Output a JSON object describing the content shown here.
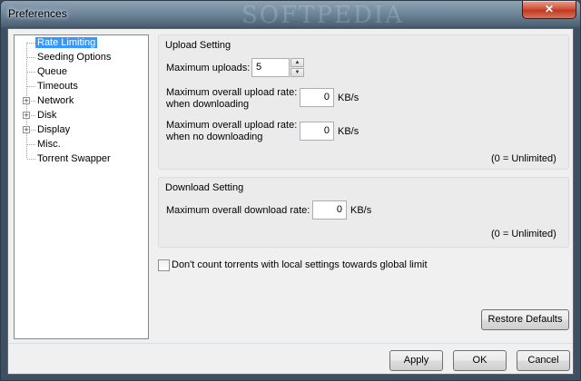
{
  "window": {
    "title": "Preferences",
    "close_glyph": "✕",
    "watermark": "SOFTPEDIA"
  },
  "tree": {
    "items": [
      {
        "label": "Rate Limiting",
        "selected": true,
        "expandable": false
      },
      {
        "label": "Seeding Options",
        "expandable": false
      },
      {
        "label": "Queue",
        "expandable": false
      },
      {
        "label": "Timeouts",
        "expandable": false
      },
      {
        "label": "Network",
        "expandable": true
      },
      {
        "label": "Disk",
        "expandable": true
      },
      {
        "label": "Display",
        "expandable": true
      },
      {
        "label": "Misc.",
        "expandable": false
      },
      {
        "label": "Torrent Swapper",
        "expandable": false
      }
    ],
    "expand_glyph": "+"
  },
  "upload": {
    "title": "Upload Setting",
    "max_uploads_label": "Maximum uploads:",
    "max_uploads_value": "5",
    "rate_downloading_label_1": "Maximum overall upload rate:",
    "rate_downloading_label_2": "when downloading",
    "rate_downloading_value": "0",
    "rate_not_downloading_label_1": "Maximum overall upload rate:",
    "rate_not_downloading_label_2": "when no downloading",
    "rate_not_downloading_value": "0",
    "unit": "KB/s",
    "note": "(0 = Unlimited)"
  },
  "download": {
    "title": "Download Setting",
    "rate_label": "Maximum overall download rate:",
    "rate_value": "0",
    "unit": "KB/s",
    "note": "(0 = Unlimited)"
  },
  "checkbox": {
    "label": "Don't count torrents with local settings towards global limit",
    "checked": false
  },
  "buttons": {
    "restore": "Restore Defaults",
    "apply": "Apply",
    "ok": "OK",
    "cancel": "Cancel"
  },
  "spin_glyphs": {
    "up": "▲",
    "down": "▼"
  }
}
